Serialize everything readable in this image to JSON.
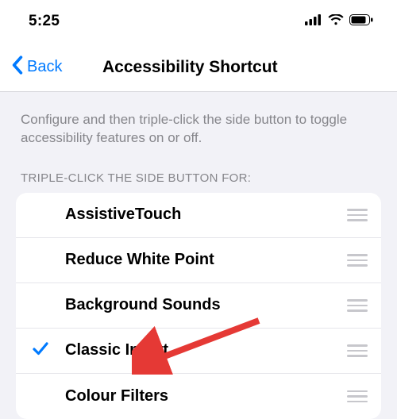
{
  "status": {
    "time": "5:25"
  },
  "header": {
    "back": "Back",
    "title": "Accessibility Shortcut"
  },
  "description": "Configure and then triple-click the side button to toggle accessibility features on or off.",
  "section_header": "TRIPLE-CLICK THE SIDE BUTTON FOR:",
  "items": [
    {
      "label": "AssistiveTouch",
      "checked": false
    },
    {
      "label": "Reduce White Point",
      "checked": false
    },
    {
      "label": "Background Sounds",
      "checked": false
    },
    {
      "label": "Classic Invert",
      "checked": true
    },
    {
      "label": "Colour Filters",
      "checked": false
    }
  ],
  "colors": {
    "accent": "#007aff",
    "arrow": "#e53935"
  }
}
